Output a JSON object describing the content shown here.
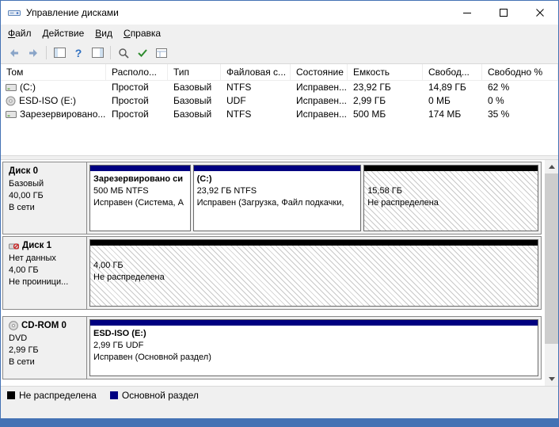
{
  "window": {
    "title": "Управление дисками"
  },
  "menu": {
    "items": [
      {
        "label": "Файл"
      },
      {
        "label": "Действие"
      },
      {
        "label": "Вид"
      },
      {
        "label": "Справка"
      }
    ]
  },
  "toolbar": {
    "help_glyph": "?"
  },
  "volume_table": {
    "columns": [
      {
        "label": "Том"
      },
      {
        "label": "Располо..."
      },
      {
        "label": "Тип"
      },
      {
        "label": "Файловая с..."
      },
      {
        "label": "Состояние"
      },
      {
        "label": "Емкость"
      },
      {
        "label": "Свобод..."
      },
      {
        "label": "Свободно %"
      }
    ],
    "rows": [
      {
        "volume": "(C:)",
        "layout": "Простой",
        "type": "Базовый",
        "filesystem": "NTFS",
        "status": "Исправен...",
        "capacity": "23,92 ГБ",
        "free": "14,89 ГБ",
        "free_percent": "62 %"
      },
      {
        "volume": "ESD-ISO (E:)",
        "layout": "Простой",
        "type": "Базовый",
        "filesystem": "UDF",
        "status": "Исправен...",
        "capacity": "2,99 ГБ",
        "free": "0 МБ",
        "free_percent": "0 %"
      },
      {
        "volume": "Зарезервировано...",
        "layout": "Простой",
        "type": "Базовый",
        "filesystem": "NTFS",
        "status": "Исправен...",
        "capacity": "500 МБ",
        "free": "174 МБ",
        "free_percent": "35 %"
      }
    ]
  },
  "disks": [
    {
      "name": "Диск 0",
      "type": "Базовый",
      "size": "40,00 ГБ",
      "status": "В сети",
      "partitions": [
        {
          "title": "Зарезервировано си",
          "size_line": "500 МБ NTFS",
          "status_line": "Исправен (Система, А",
          "bar_color": "#000080"
        },
        {
          "title": "(C:)",
          "size_line": "23,92 ГБ NTFS",
          "status_line": "Исправен (Загрузка, Файл подкачки,",
          "bar_color": "#000080"
        },
        {
          "title": "",
          "size_line": "15,58 ГБ",
          "status_line": "Не распределена",
          "bar_color": "#000000"
        }
      ]
    },
    {
      "name": "Диск 1",
      "type": "Нет данных",
      "size": "4,00 ГБ",
      "status": "Не проиници...",
      "partitions": [
        {
          "title": "",
          "size_line": "4,00 ГБ",
          "status_line": "Не распределена",
          "bar_color": "#000000"
        }
      ]
    },
    {
      "name": "CD-ROM 0",
      "type": "DVD",
      "size": "2,99 ГБ",
      "status": "В сети",
      "partitions": [
        {
          "title": "ESD-ISO  (E:)",
          "size_line": "2,99 ГБ UDF",
          "status_line": "Исправен (Основной раздел)",
          "bar_color": "#000080"
        }
      ]
    }
  ],
  "legend": {
    "items": [
      {
        "label": "Не распределена",
        "color": "#000000"
      },
      {
        "label": "Основной раздел",
        "color": "#000080"
      }
    ]
  },
  "colors": {
    "accent_border": "#4472b4",
    "primary_partition": "#000080",
    "unallocated": "#000000"
  }
}
